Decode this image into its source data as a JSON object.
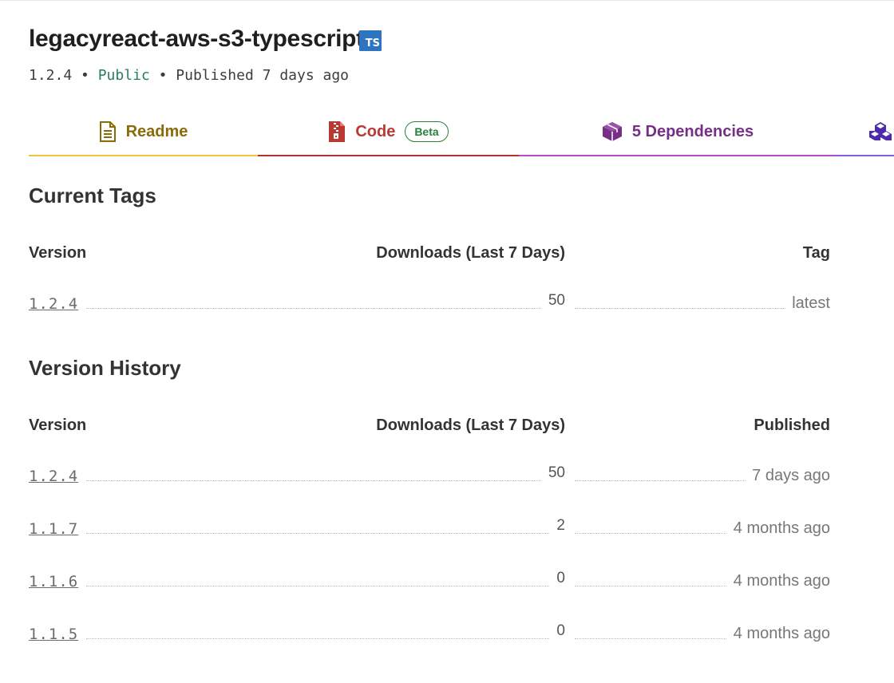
{
  "package": {
    "name": "legacyreact-aws-s3-typescript",
    "ts_badge": "TS",
    "version": "1.2.4",
    "sep1": "•",
    "visibility": "Public",
    "sep2": "•",
    "published": "Published 7 days ago"
  },
  "tabs": {
    "readme": "Readme",
    "code": "Code",
    "code_badge": "Beta",
    "dependencies": "5 Dependencies"
  },
  "current_tags": {
    "title": "Current Tags",
    "headers": {
      "version": "Version",
      "downloads": "Downloads (Last 7 Days)",
      "tag": "Tag"
    },
    "rows": [
      {
        "version": "1.2.4",
        "downloads": "50",
        "tag": "latest"
      }
    ]
  },
  "version_history": {
    "title": "Version History",
    "headers": {
      "version": "Version",
      "downloads": "Downloads (Last 7 Days)",
      "published": "Published"
    },
    "rows": [
      {
        "version": "1.2.4",
        "downloads": "50",
        "published": "7 days ago"
      },
      {
        "version": "1.1.7",
        "downloads": "2",
        "published": "4 months ago"
      },
      {
        "version": "1.1.6",
        "downloads": "0",
        "published": "4 months ago"
      },
      {
        "version": "1.1.5",
        "downloads": "0",
        "published": "4 months ago"
      }
    ]
  },
  "colors": {
    "public": "#2a7e5b",
    "readme": "#8a6a09",
    "code": "#b83a32",
    "dependencies": "#772e86",
    "ts_badge": "#2f74c0"
  },
  "icons": {
    "readme": "document-icon",
    "code": "zip-file-icon",
    "dependencies": "box-icon",
    "dependents": "boxes-icon"
  }
}
